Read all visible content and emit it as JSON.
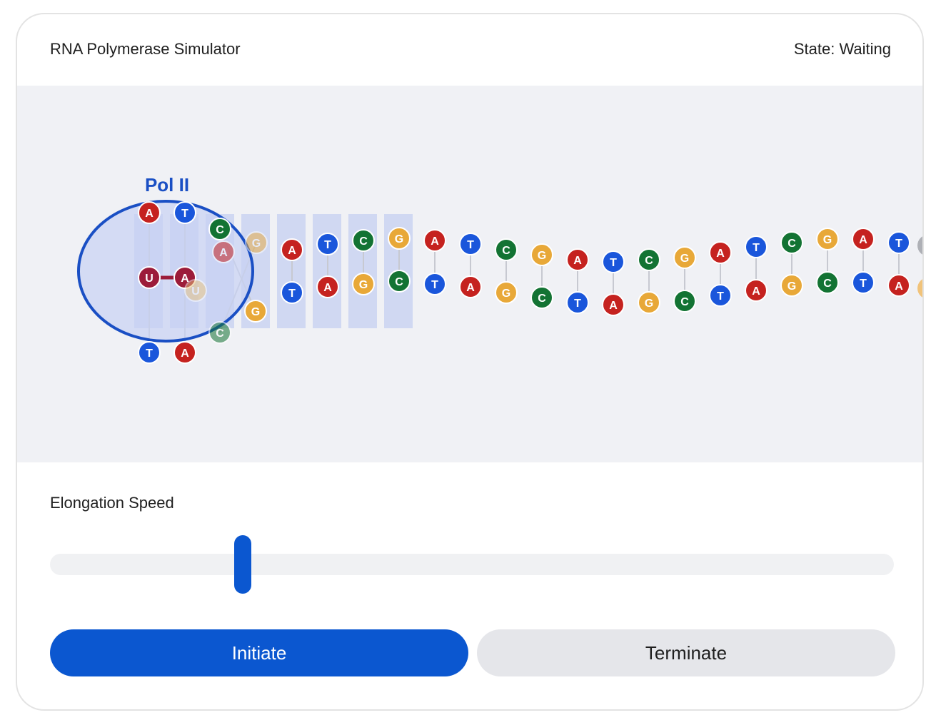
{
  "header": {
    "title": "RNA Polymerase Simulator",
    "state": "State: Waiting"
  },
  "simulation": {
    "enzyme_label": "Pol II",
    "transcript": [
      "U",
      "A"
    ],
    "top_strand": [
      "A",
      "T",
      "C",
      "G",
      "A",
      "T",
      "C",
      "G",
      "A",
      "T",
      "C",
      "G",
      "A",
      "T",
      "C",
      "G",
      "A",
      "T",
      "C",
      "G",
      "A",
      "T"
    ],
    "bottom_strand": [
      "T",
      "A",
      "G",
      "C",
      "T",
      "A",
      "G",
      "C",
      "T",
      "A",
      "G",
      "C",
      "T",
      "A",
      "G",
      "C",
      "T",
      "A",
      "G",
      "C",
      "T",
      "A"
    ],
    "colors": {
      "A": "#c5221f",
      "T": "#1a56db",
      "C": "#137333",
      "G": "#e8a838",
      "U": "#9c1c3a",
      "enzyme": "#1a4fc4"
    }
  },
  "controls": {
    "speed_label": "Elongation Speed",
    "speed_fraction": 0.23,
    "initiate_label": "Initiate",
    "terminate_label": "Terminate"
  }
}
